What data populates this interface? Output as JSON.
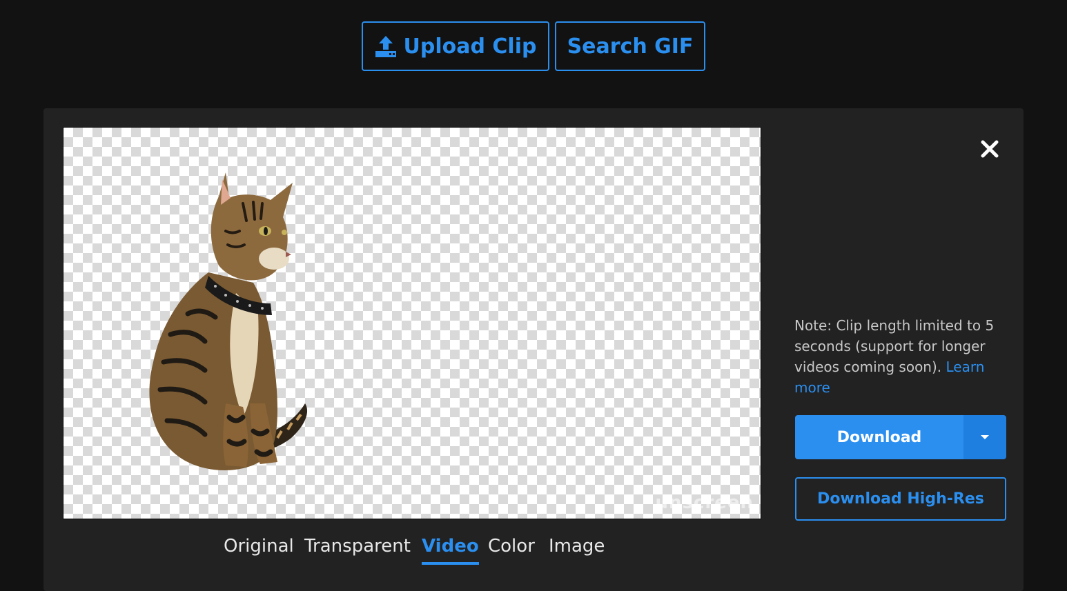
{
  "header": {
    "upload_label": "Upload Clip",
    "upload_icon": "upload-icon",
    "search_label": "Search GIF"
  },
  "preview": {
    "subject": "cat",
    "watermark": "unscreen"
  },
  "tabs": [
    {
      "label": "Original",
      "active": false
    },
    {
      "label": "Transparent",
      "active": false
    },
    {
      "label": "Video",
      "active": true
    },
    {
      "label": "Color",
      "active": false
    },
    {
      "label": "Image",
      "active": false
    }
  ],
  "sidebar": {
    "close_icon": "close-icon",
    "note_text": "Note: Clip length limited to 5 seconds (support for longer videos coming soon).",
    "note_link": "Learn more",
    "download_label": "Download",
    "download_caret_icon": "caret-down-icon",
    "hires_label": "Download High-Res"
  },
  "colors": {
    "accent": "#2b8ff0",
    "background": "#121212",
    "panel": "#222222"
  }
}
